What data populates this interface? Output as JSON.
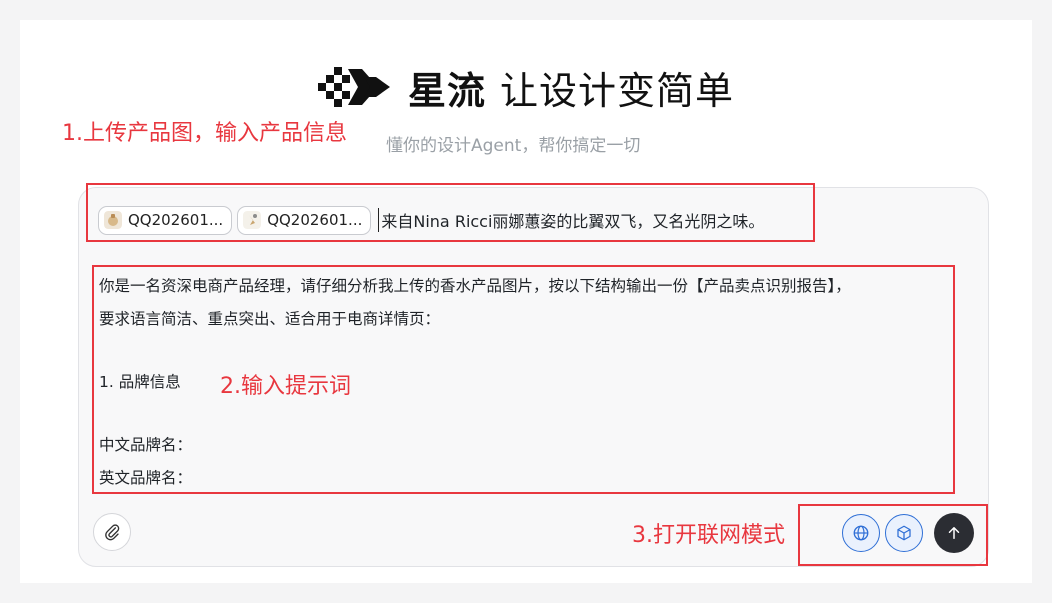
{
  "header": {
    "brand": "星流",
    "tagline": "让设计变简单",
    "subtitle": "懂你的设计Agent，帮你搞定一切"
  },
  "composer": {
    "attachments": [
      {
        "label": "QQ202601...",
        "icon": "image-thumbnail-icon"
      },
      {
        "label": "QQ202601...",
        "icon": "image-thumbnail-icon"
      }
    ],
    "caption": "来自Nina Ricci丽娜蕙姿的比翼双飞，又名光阴之味。",
    "prompt_lines": [
      "你是一名资深电商产品经理，请仔细分析我上传的香水产品图片，按以下结构输出一份【产品卖点识别报告】，",
      "要求语言简洁、重点突出、适合用于电商详情页：",
      "",
      "1. 品牌信息",
      "",
      "中文品牌名：",
      "英文品牌名："
    ],
    "buttons": {
      "attach_icon": "paperclip-icon",
      "web_icon": "globe-icon",
      "model_icon": "cube-icon",
      "send_icon": "arrow-up-icon"
    }
  },
  "annotations": {
    "step1": "1.上传产品图，输入产品信息",
    "step2": "2.输入提示词",
    "step3": "3.打开联网模式",
    "color": "#e8373f"
  },
  "colors": {
    "web_button_accent": "#2f6fd6",
    "send_button_bg": "#2b2d33"
  }
}
